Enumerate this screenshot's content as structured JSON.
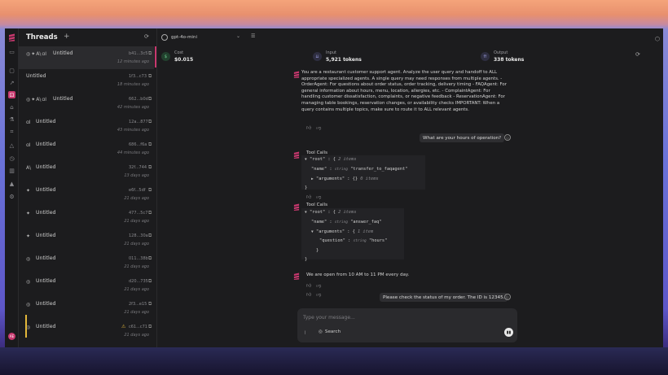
{
  "sidebar": {
    "title": "Threads",
    "items": [
      {
        "name": "Untitled",
        "hash": "b41...3c5",
        "time": "12 minutes ago",
        "icons": [
          "openai",
          "gemini",
          "anthropic",
          "ai"
        ]
      },
      {
        "name": "Untitled",
        "hash": "1f3...c73",
        "time": "18 minutes ago",
        "icons": []
      },
      {
        "name": "Untitled",
        "hash": "662...b0d",
        "time": "42 minutes ago",
        "icons": [
          "openai",
          "gemini",
          "anthropic",
          "ai"
        ]
      },
      {
        "name": "Untitled",
        "hash": "12a...877",
        "time": "43 minutes ago",
        "icons": [
          "ai"
        ]
      },
      {
        "name": "Untitled",
        "hash": "686...f6a",
        "time": "44 minutes ago",
        "icons": [
          "ai"
        ]
      },
      {
        "name": "Untitled",
        "hash": "32f...744",
        "time": "13 days ago",
        "icons": [
          "anthropic"
        ]
      },
      {
        "name": "Untitled",
        "hash": "e6f...5df",
        "time": "21 days ago",
        "icons": [
          "gemini"
        ]
      },
      {
        "name": "Untitled",
        "hash": "477...5c7",
        "time": "21 days ago",
        "icons": [
          "gemini"
        ]
      },
      {
        "name": "Untitled",
        "hash": "128...30a",
        "time": "21 days ago",
        "icons": [
          "gemini"
        ]
      },
      {
        "name": "Untitled",
        "hash": "011...38b",
        "time": "21 days ago",
        "icons": [
          "openai"
        ]
      },
      {
        "name": "Untitled",
        "hash": "d20...735",
        "time": "21 days ago",
        "icons": [
          "openai"
        ]
      },
      {
        "name": "Untitled",
        "hash": "2f3...e15",
        "time": "21 days ago",
        "icons": [
          "openai"
        ]
      },
      {
        "name": "Untitled",
        "hash": "c61...c71",
        "time": "21 days ago",
        "icons": [
          "openai"
        ],
        "warning": true
      }
    ]
  },
  "topbar": {
    "model": "gpt-4o-mini"
  },
  "stats": {
    "cost": {
      "label": "Cost",
      "value": "$0.015"
    },
    "input": {
      "label": "Input",
      "value": "5,921 tokens"
    },
    "output": {
      "label": "Output",
      "value": "338 tokens"
    }
  },
  "chat": {
    "system_text": "You are a restaurant customer support agent. Analyze the user query and handoff to ALL appropriate specialized agents. A single query may need responses from multiple agents. - OrderAgent: For questions about order status, order tracking, delivery timing - FAQAgent: For general information about hours, menu, location, allergies, etc. - ComplaintAgent: For handling customer dissatisfaction, complaints, or negative feedback - ReservationAgent: For managing table bookings, reservation changes, or availability checks IMPORTANT: When a query contains multiple topics, make sure to route it to ALL relevant agents.",
    "user1": "What are your hours of operation?",
    "tool_calls_label": "Tool Calls",
    "tc1": {
      "root": "\"root\"",
      "root_meta": "2 items",
      "name_key": "\"name\"",
      "name_type": "string",
      "name_val": "\"transfer_to_faqagent\"",
      "args_key": "\"arguments\"",
      "args_val": "{}",
      "args_meta": "0 items"
    },
    "tc2": {
      "root": "\"root\"",
      "root_meta": "2 items",
      "name_key": "\"name\"",
      "name_type": "string",
      "name_val": "\"answer_faq\"",
      "args_key": "\"arguments\"",
      "args_meta": "1 item",
      "q_key": "\"question\"",
      "q_type": "string",
      "q_val": "\"hours\""
    },
    "assistant_reply": "We are open from 10 AM to 11 PM every day.",
    "user2": "Please check the status of my order. The ID is 12345."
  },
  "composer": {
    "placeholder": "Type your message...",
    "search_label": "Search"
  },
  "colors": {
    "accent": "#c8386e",
    "warning": "#e2b73a"
  }
}
